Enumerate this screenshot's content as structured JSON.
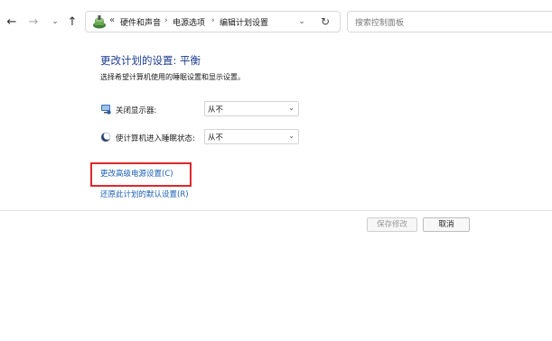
{
  "nav": {
    "back_icon": "←",
    "forward_icon": "→",
    "recent_icon": "⌄",
    "up_icon": "↑"
  },
  "address": {
    "overflow": "«",
    "crumbs": [
      "硬件和声音",
      "电源选项",
      "编辑计划设置"
    ],
    "separator": "›",
    "dropdown_icon": "⌄",
    "refresh_icon": "↻"
  },
  "search": {
    "placeholder": "搜索控制面板"
  },
  "main": {
    "title": "更改计划的设置: 平衡",
    "subtitle": "选择希望计算机使用的睡眠设置和显示设置。",
    "settings": [
      {
        "label": "关闭显示器:",
        "value": "从不",
        "icon": "monitor-icon"
      },
      {
        "label": "使计算机进入睡眠状态:",
        "value": "从不",
        "icon": "moon-icon"
      }
    ],
    "links": {
      "advanced": "更改高级电源设置(C)",
      "restore": "还原此计划的默认设置(R)"
    }
  },
  "footer": {
    "save_label": "保存修改",
    "cancel_label": "取消"
  },
  "colors": {
    "title": "#1e3d8f",
    "link": "#1a5fb4",
    "highlight": "#e0262b"
  }
}
